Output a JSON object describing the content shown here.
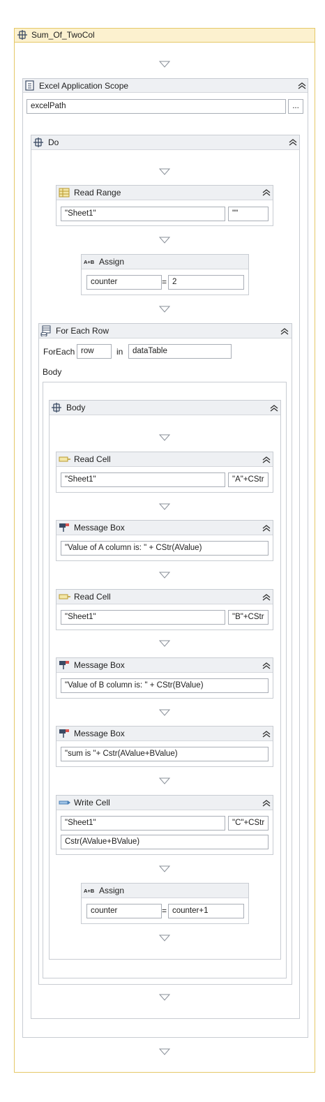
{
  "workflow": {
    "title": "Sum_Of_TwoCol",
    "excel_scope": {
      "title": "Excel Application Scope",
      "path": "excelPath",
      "browse_label": "...",
      "do": {
        "title": "Do",
        "read_range": {
          "title": "Read Range",
          "sheet": "\"Sheet1\"",
          "range": "\"\""
        },
        "assign1": {
          "title": "Assign",
          "icon_text": "A+B",
          "to": "counter",
          "eq": "=",
          "value": "2"
        },
        "for_each": {
          "title": "For Each Row",
          "foreach_label": "ForEach",
          "item": "row",
          "in_label": "in",
          "collection": "dataTable",
          "body_label": "Body",
          "body": {
            "title": "Body",
            "read_cell_a": {
              "title": "Read Cell",
              "sheet": "\"Sheet1\"",
              "cell": "\"A\"+CStr"
            },
            "msg_a": {
              "title": "Message Box",
              "text": "\"Value of A column is: \" + CStr(AValue)"
            },
            "read_cell_b": {
              "title": "Read Cell",
              "sheet": "\"Sheet1\"",
              "cell": "\"B\"+CStr"
            },
            "msg_b": {
              "title": "Message Box",
              "text": "\"Value of B column is: \" + CStr(BValue)"
            },
            "msg_sum": {
              "title": "Message Box",
              "text": "\"sum is \"+ Cstr(AValue+BValue)"
            },
            "write_cell": {
              "title": "Write Cell",
              "sheet": "\"Sheet1\"",
              "cell": "\"C\"+CStr",
              "value": "Cstr(AValue+BValue)"
            },
            "assign2": {
              "title": "Assign",
              "icon_text": "A+B",
              "to": "counter",
              "eq": "=",
              "value": "counter+1"
            }
          }
        }
      }
    }
  },
  "colors": {
    "root_header": "#fcf1cf",
    "root_border": "#e5c867",
    "header_bg": "#eef0f3",
    "border": "#c8ccd2"
  },
  "icons": [
    "sequence-icon",
    "excel-scope-icon",
    "read-range-icon",
    "assign-icon",
    "for-each-icon",
    "read-cell-icon",
    "message-box-icon",
    "write-cell-icon",
    "drop-arrow-icon",
    "collapse-chevron-icon"
  ]
}
